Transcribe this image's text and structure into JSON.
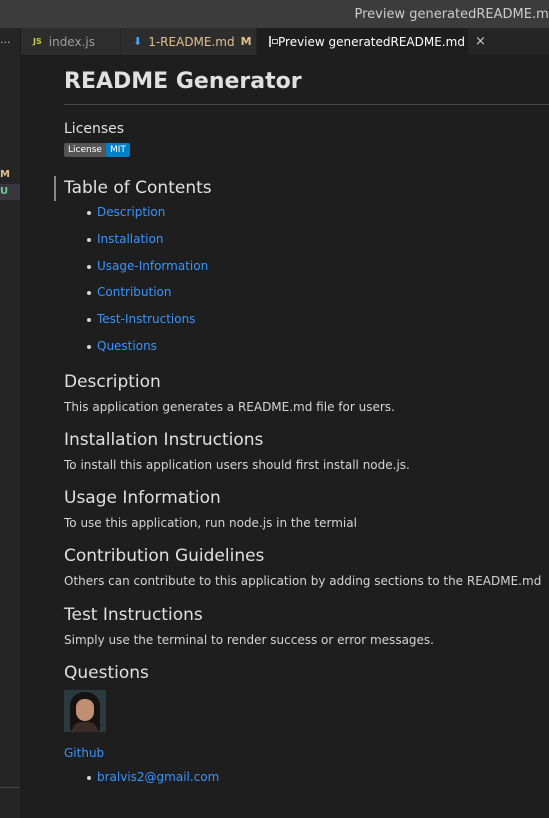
{
  "window": {
    "title": "Preview generatedREADME.md"
  },
  "sidebar": {
    "more": "···",
    "badge_m": "M",
    "badge_u": "U"
  },
  "tabs": [
    {
      "icon": "JS",
      "label": "index.js"
    },
    {
      "label": "1-README.md",
      "status": "M"
    },
    {
      "label": "Preview generatedREADME.md",
      "close": "×"
    }
  ],
  "doc": {
    "title": "README Generator",
    "licenses_heading": "Licenses",
    "badge": {
      "left": "License",
      "right": "MIT"
    },
    "toc_heading": "Table of Contents",
    "toc": [
      "Description",
      "Installation",
      "Usage-Information",
      "Contribution",
      "Test-Instructions",
      "Questions"
    ],
    "description": {
      "heading": "Description",
      "text": "This application generates a README.md file for users."
    },
    "installation": {
      "heading": "Installation Instructions",
      "text": "To install this application users should first install node.js."
    },
    "usage": {
      "heading": "Usage Information",
      "text": "To use this application, run node.js in the termial"
    },
    "contribution": {
      "heading": "Contribution Guidelines",
      "text": "Others can contribute to this application by adding sections to the README.md"
    },
    "tests": {
      "heading": "Test Instructions",
      "text": "Simply use the terminal to render success or error messages."
    },
    "questions": {
      "heading": "Questions",
      "github": "Github",
      "email": "bralvis2@gmail.com"
    }
  },
  "colors": {
    "link": "#3794ff",
    "background": "#1e1e1e",
    "modified": "#e2c08d",
    "badge_right": "#007ec6"
  }
}
